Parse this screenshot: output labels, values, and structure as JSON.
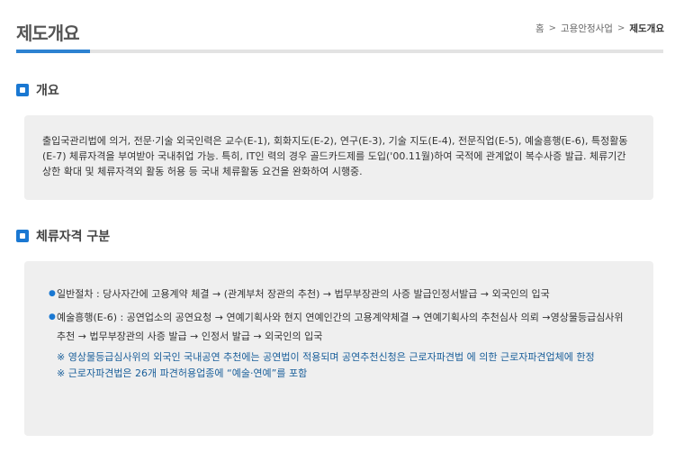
{
  "header": {
    "title": "제도개요",
    "breadcrumb": {
      "home": "홈",
      "parent": "고용안정사업",
      "current": "제도개요",
      "separator": ">"
    }
  },
  "sections": {
    "overview": {
      "title": "개요",
      "body": "출입국관리법에 의거, 전문·기술 외국인력은 교수(E-1), 회화지도(E-2), 연구(E-3), 기술 지도(E-4), 전문직업(E-5), 예술흥행(E-6), 특정활동(E-7) 체류자격을 부여받아 국내취업 가능. 특히, IT인 력의 경우 골드카드제를 도입('00.11월)하여 국적에 관계없이 복수사증 발급. 체류기간 상한 확대 및 체류자격외 활동 허용 등 국내 체류활동 요건을 완화하여 시행중."
    },
    "status": {
      "title": "체류자격 구분",
      "items": [
        {
          "text": "일반절차 : 당사자간에 고용계약 체결 → (관계부처 장관의 추천) → 법무부장관의 사증 발급인정서발급 → 외국인의 입국"
        },
        {
          "text": "예술흥행(E-6) : 공연업소의 공연요청 → 연예기획사와 현지 연예인간의 고용계약체결 → 연예기획사의 추천심사 의뢰 →영상물등급심사위 추천 → 법무부장관의 사증 발급 → 인정서 발급 → 외국인의 입국"
        }
      ],
      "notes": [
        "※ 영상물등급심사위의 외국인 국내공연 추천에는 공연법이 적용되며 공연추천신청은 근로자파견법 에 의한 근로자파견업체에 한정",
        "※ 근로자파견법은 26개 파견허용업종에 “예술·연예”를 포함"
      ]
    }
  },
  "colors": {
    "accent": "#2d82d1",
    "icon": "#1a78d2",
    "note": "#1a5f9a",
    "box_bg": "#efefef"
  },
  "icons": {
    "section": "square-bullet-icon",
    "list": "dot-bullet-icon"
  }
}
